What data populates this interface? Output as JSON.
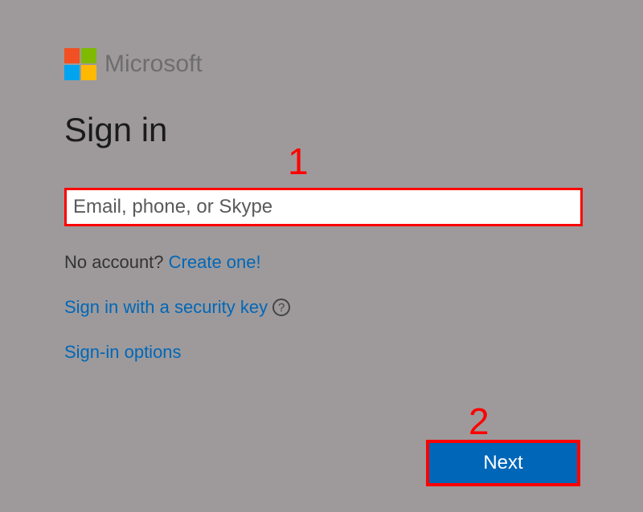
{
  "brand": {
    "name": "Microsoft"
  },
  "heading": "Sign in",
  "input": {
    "placeholder": "Email, phone, or Skype",
    "value": ""
  },
  "noAccount": {
    "text": "No account? ",
    "link": "Create one!"
  },
  "securityKey": {
    "text": "Sign in with a security key",
    "helpGlyph": "?"
  },
  "signinOptions": "Sign-in options",
  "nextButton": "Next",
  "annotations": {
    "one": "1",
    "two": "2"
  }
}
